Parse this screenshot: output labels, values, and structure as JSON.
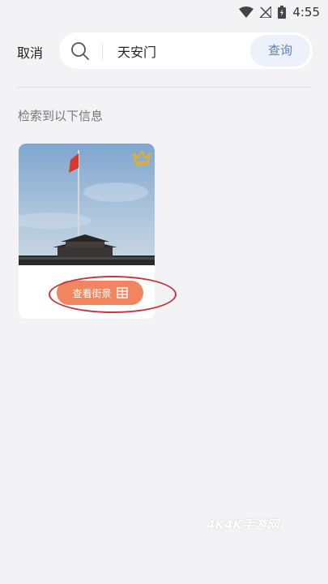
{
  "status_bar": {
    "time": "4:55",
    "icons": [
      "wifi-icon",
      "no-signal-icon",
      "battery-icon"
    ]
  },
  "header": {
    "cancel_label": "取消",
    "search": {
      "value": "天安门",
      "icon": "search-icon"
    },
    "query_label": "查询"
  },
  "results": {
    "label": "检索到以下信息",
    "items": [
      {
        "image": "tiananmen-flag-photo",
        "badge_icon": "crown-icon",
        "button_label": "查看街景",
        "button_icon": "street-view-icon"
      }
    ]
  },
  "watermark": "4K4K手游网",
  "colors": {
    "background": "#f3f3f5",
    "accent": "#f0855f",
    "query_text": "#5a7ec0",
    "annotation_circle": "#c53540",
    "crown": "#e8b020"
  }
}
